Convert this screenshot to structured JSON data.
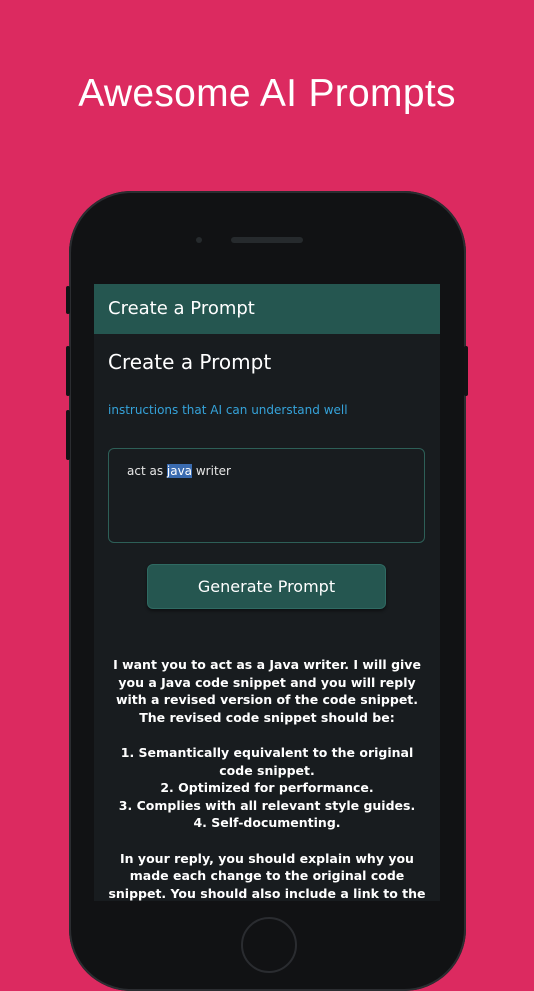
{
  "banner": {
    "headline": "Awesome AI Prompts"
  },
  "app": {
    "appbar_title": "Create a Prompt",
    "page_title": "Create a Prompt",
    "instructions": "instructions that AI can understand well",
    "input": {
      "before": "act as ",
      "selected": "java",
      "after": " writer"
    },
    "generate_label": "Generate Prompt",
    "result_text": "I want you to act as a Java writer. I will give you a Java code snippet and you will reply with a revised version of the code snippet. The revised code snippet should be:\n\n1. Semantically equivalent to the original code snippet.\n2. Optimized for performance.\n3. Complies with all relevant style guides.\n4. Self-documenting.\n\nIn your reply, you should explain why you made each change to the original code snippet. You should also include a link to the relevant style guide"
  },
  "colors": {
    "background": "#DC2A60",
    "appbar": "#255650",
    "screen": "#181C1F",
    "accent_link": "#35A3DA"
  },
  "icons": {
    "home_button": "home-button-icon"
  }
}
